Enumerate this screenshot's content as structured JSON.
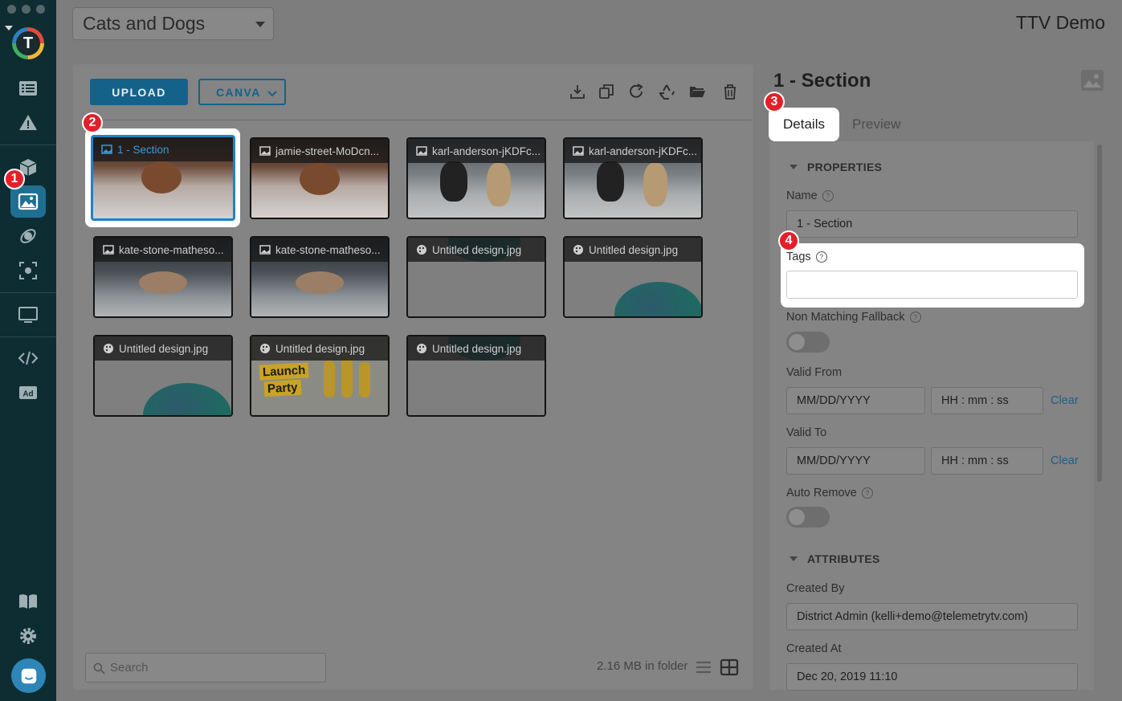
{
  "header": {
    "folder_select_value": "Cats and Dogs",
    "app_title": "TTV Demo"
  },
  "sidebar": {
    "logo_letter": "T",
    "items": [
      {
        "name": "playlist",
        "icon": "list-icon"
      },
      {
        "name": "alerts",
        "icon": "warning-icon"
      },
      {
        "name": "apps",
        "icon": "cube-icon"
      },
      {
        "name": "media",
        "icon": "image-icon",
        "active": true
      },
      {
        "name": "feeds",
        "icon": "satellite-icon"
      },
      {
        "name": "screenshots",
        "icon": "capture-icon"
      },
      {
        "name": "devices",
        "icon": "monitor-icon"
      },
      {
        "name": "developer",
        "icon": "code-icon"
      },
      {
        "name": "ads",
        "icon": "ad-icon",
        "label": "Ad"
      },
      {
        "name": "docs",
        "icon": "book-icon"
      },
      {
        "name": "settings",
        "icon": "gear-icon"
      },
      {
        "name": "help",
        "icon": "chat-icon"
      }
    ]
  },
  "toolbar": {
    "upload_label": "UPLOAD",
    "canva_label": "CANVA"
  },
  "media": [
    {
      "caption": "1 - Section",
      "kind": "image"
    },
    {
      "caption": "jamie-street-MoDcn...",
      "kind": "image"
    },
    {
      "caption": "karl-anderson-jKDFc...",
      "kind": "image"
    },
    {
      "caption": "karl-anderson-jKDFc...",
      "kind": "image"
    },
    {
      "caption": "kate-stone-matheso...",
      "kind": "image"
    },
    {
      "caption": "kate-stone-matheso...",
      "kind": "image"
    },
    {
      "caption": "Untitled design.jpg",
      "kind": "canva"
    },
    {
      "caption": "Untitled design.jpg",
      "kind": "canva"
    },
    {
      "caption": "Untitled design.jpg",
      "kind": "canva"
    },
    {
      "caption": "Untitled design.jpg",
      "kind": "canva"
    },
    {
      "caption": "Untitled design.jpg",
      "kind": "canva"
    }
  ],
  "party_text": {
    "line1": "Launch",
    "line2": "Party"
  },
  "footer": {
    "search_placeholder": "Search",
    "folder_size": "2.16 MB in folder"
  },
  "details": {
    "title": "1 - Section",
    "tabs": [
      "Details",
      "Preview"
    ],
    "properties_header": "PROPERTIES",
    "name_label": "Name",
    "name_value": "1 - Section",
    "tags_label": "Tags",
    "tags_value": "",
    "fallback_label": "Non Matching Fallback",
    "valid_from_label": "Valid From",
    "valid_to_label": "Valid To",
    "date_placeholder": "MM/DD/YYYY",
    "time_placeholder": "HH : mm : ss",
    "clear_label": "Clear",
    "auto_remove_label": "Auto Remove",
    "attributes_header": "ATTRIBUTES",
    "created_by_label": "Created By",
    "created_by_value": "District Admin (kelli+demo@telemetrytv.com)",
    "created_at_label": "Created At",
    "created_at_value": "Dec 20, 2019 11:10"
  },
  "steps": [
    "1",
    "2",
    "3",
    "4"
  ],
  "colors": {
    "accent": "#14628a",
    "step_badge": "#e3202a",
    "sidebar_bg": "#0e2d33"
  }
}
